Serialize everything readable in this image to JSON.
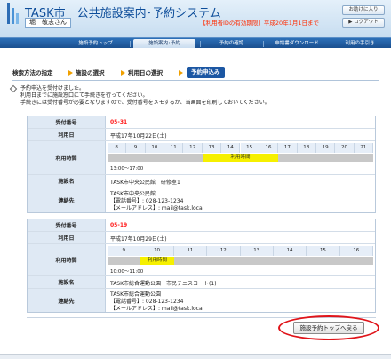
{
  "header": {
    "system_title": "TASK市　公共施設案内･予約システム",
    "user_name": "堀　敬志さん",
    "user_suffix": "",
    "expiry_notice": "【利用者IDの有効期限】平成20年1月1日まで",
    "btn_help": "お助けに入り",
    "btn_logout": "ログアウト"
  },
  "nav": {
    "items": [
      {
        "label": "施設予約トップ",
        "active": false
      },
      {
        "label": "施設案内･予約",
        "active": true
      },
      {
        "label": "予約の確認",
        "active": false
      },
      {
        "label": "申請書ダウンロード",
        "active": false
      },
      {
        "label": "利用の手引き",
        "active": false
      }
    ]
  },
  "breadcrumb": {
    "step1": "検索方法の指定",
    "step2": "施設の選択",
    "step3": "利用日の選択",
    "step4": "予約申込み"
  },
  "message": {
    "line1": "予約申込を受付けました。",
    "line2": "利用日までに施設窓口にて手続きを行ってください。",
    "line3": "手続きには受付番号が必要となりますので、受付番号をメモするか、当画面を印刷しておいてください。"
  },
  "labels": {
    "receipt_no": "受付番号",
    "date": "利用日",
    "time": "利用時間",
    "facility": "施設名",
    "contact": "連絡先"
  },
  "reservations": [
    {
      "receipt_no": "05-31",
      "date": "平成17年10月22日(土)",
      "hours": [
        "8",
        "9",
        "10",
        "11",
        "12",
        "13",
        "14",
        "15",
        "16",
        "17",
        "18",
        "19",
        "20",
        "21"
      ],
      "selected_label": "利用時間",
      "selected_range": [
        13,
        17
      ],
      "time_text": "13:00～17:00",
      "facility": "TASK市中央公民館　研修室1",
      "contact_name": "TASK市中央公民館",
      "contact_tel": "【電話番号】: 028-123-1234",
      "contact_mail": "【メールアドレス】: mail@task.local"
    },
    {
      "receipt_no": "05-19",
      "date": "平成17年10月29日(土)",
      "hours": [
        "9",
        "10",
        "11",
        "12",
        "13",
        "14",
        "15",
        "16"
      ],
      "selected_label": "利用時間",
      "selected_range": [
        10,
        11
      ],
      "time_text": "10:00～11:00",
      "facility": "TASK市総合運動公園　市民テニスコート(1)",
      "contact_name": "TASK市総合運動公園",
      "contact_tel": "【電話番号】: 028-123-1234",
      "contact_mail": "【メールアドレス】: mail@task.local"
    }
  ],
  "footer": {
    "back_button": "施設予約トップへ戻る"
  },
  "colors": {
    "nav_bg": "#1f5a9f",
    "accent_red": "#ff1a1a",
    "highlight_yellow": "#f6f000",
    "ring_red": "#e0141a"
  }
}
